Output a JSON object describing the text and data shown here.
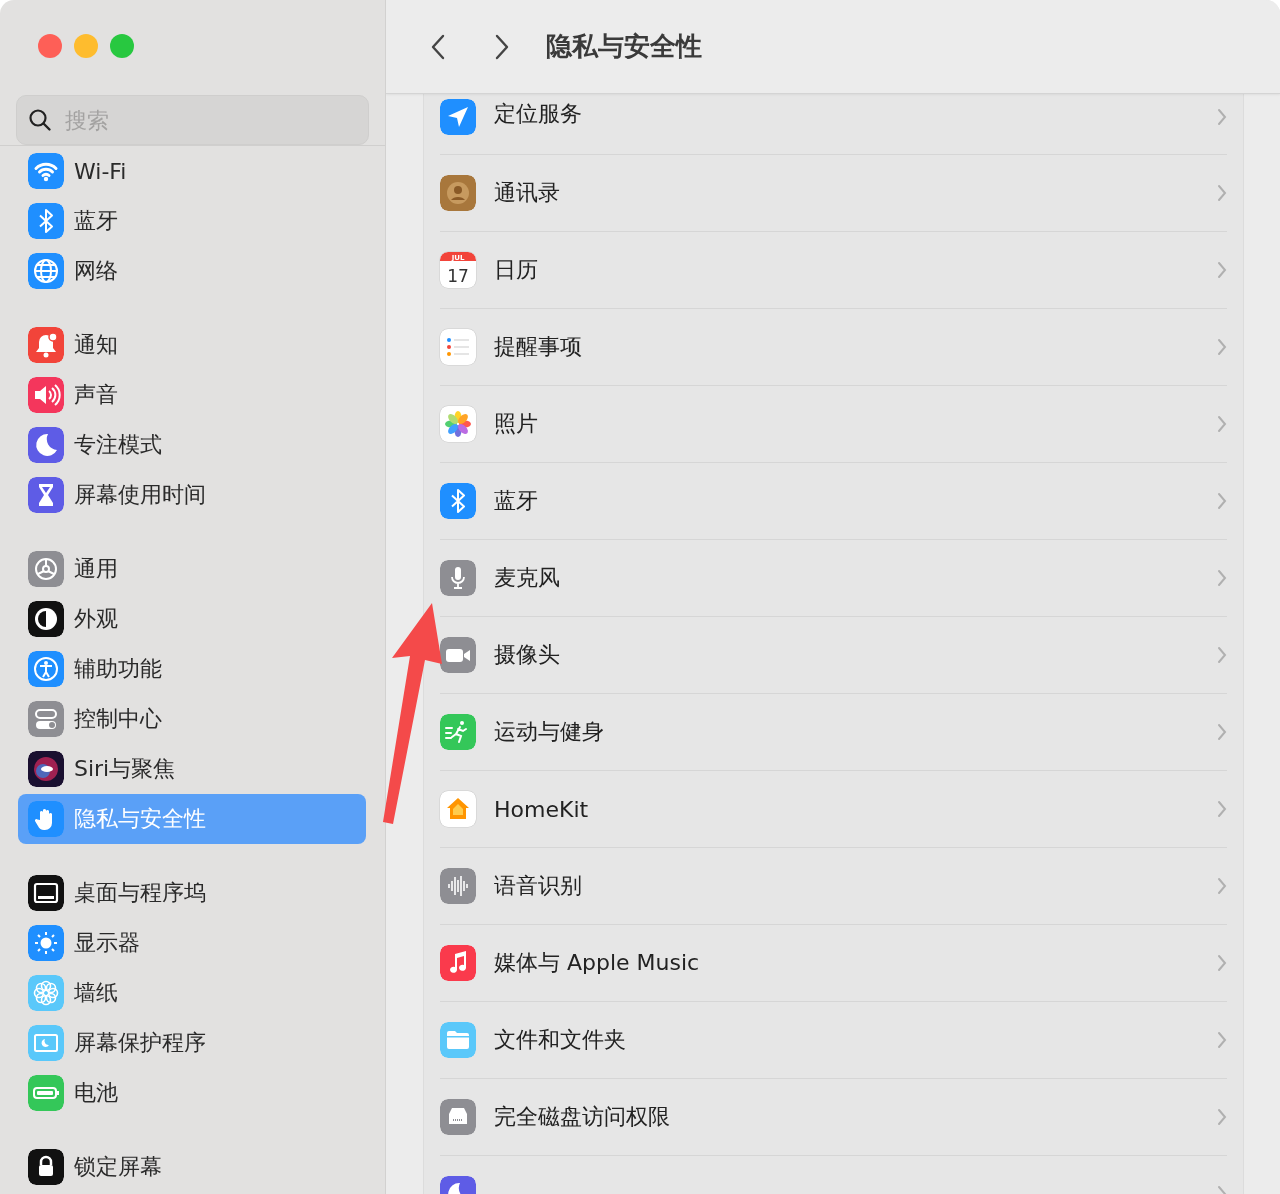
{
  "window": {
    "title": "隐私与安全性"
  },
  "search": {
    "placeholder": "搜索"
  },
  "sidebar": {
    "groups": [
      [
        {
          "label": "Wi-Fi",
          "selected": false
        },
        {
          "label": "蓝牙",
          "selected": false
        },
        {
          "label": "网络",
          "selected": false
        }
      ],
      [
        {
          "label": "通知",
          "selected": false
        },
        {
          "label": "声音",
          "selected": false
        },
        {
          "label": "专注模式",
          "selected": false
        },
        {
          "label": "屏幕使用时间",
          "selected": false
        }
      ],
      [
        {
          "label": "通用",
          "selected": false
        },
        {
          "label": "外观",
          "selected": false
        },
        {
          "label": "辅助功能",
          "selected": false
        },
        {
          "label": "控制中心",
          "selected": false
        },
        {
          "label": "Siri与聚焦",
          "selected": false
        },
        {
          "label": "隐私与安全性",
          "selected": true
        }
      ],
      [
        {
          "label": "桌面与程序坞",
          "selected": false
        },
        {
          "label": "显示器",
          "selected": false
        },
        {
          "label": "墙纸",
          "selected": false
        },
        {
          "label": "屏幕保护程序",
          "selected": false
        },
        {
          "label": "电池",
          "selected": false
        }
      ],
      [
        {
          "label": "锁定屏幕",
          "selected": false
        }
      ]
    ]
  },
  "rows": [
    {
      "label": "定位服务"
    },
    {
      "label": "通讯录"
    },
    {
      "label": "日历",
      "icon_month": "JUL",
      "icon_day": "17"
    },
    {
      "label": "提醒事项"
    },
    {
      "label": "照片"
    },
    {
      "label": "蓝牙"
    },
    {
      "label": "麦克风"
    },
    {
      "label": "摄像头"
    },
    {
      "label": "运动与健身"
    },
    {
      "label": "HomeKit"
    },
    {
      "label": "语音识别"
    },
    {
      "label": "媒体与 Apple Music"
    },
    {
      "label": "文件和文件夹"
    },
    {
      "label": "完全磁盘访问权限"
    },
    {}
  ]
}
